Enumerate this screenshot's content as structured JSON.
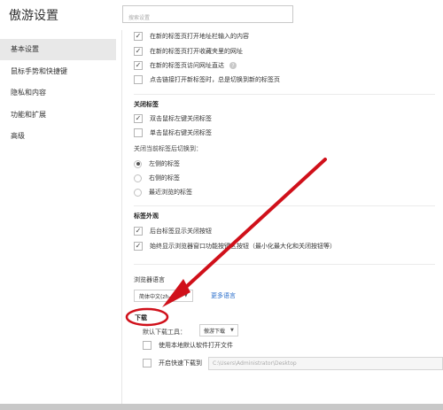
{
  "app": {
    "title": "傲游设置"
  },
  "search": {
    "placeholder": "搜索设置"
  },
  "sidebar": {
    "items": [
      {
        "label": "基本设置",
        "active": true
      },
      {
        "label": "鼠标手势和快捷键",
        "active": false
      },
      {
        "label": "隐私和内容",
        "active": false
      },
      {
        "label": "功能和扩展",
        "active": false
      },
      {
        "label": "高级",
        "active": false
      }
    ]
  },
  "tab_open": {
    "items": [
      {
        "label": "在新的标签页打开地址栏输入的内容",
        "checked": true
      },
      {
        "label": "在新的标签页打开收藏夹里的网址",
        "checked": true
      },
      {
        "label": "在新的标签页访问网址直达",
        "checked": true
      },
      {
        "label": "点击链接打开新标签时，总是切换到新的标签页",
        "checked": false
      }
    ]
  },
  "close_tab": {
    "title": "关闭标签",
    "items": [
      {
        "label": "双击鼠标左键关闭标签",
        "checked": true
      },
      {
        "label": "单击鼠标右键关闭标签",
        "checked": false
      }
    ],
    "switch_label": "关闭当前标签后切换到：",
    "options": [
      {
        "label": "左侧的标签",
        "selected": true
      },
      {
        "label": "右侧的标签",
        "selected": false
      },
      {
        "label": "最近浏览的标签",
        "selected": false
      }
    ]
  },
  "tab_appearance": {
    "title": "标签外观",
    "items": [
      {
        "label": "后台标签显示关闭按钮",
        "checked": true
      },
      {
        "label": "始终显示浏览器窗口功能按键区按钮（最小化最大化和关闭按钮等）",
        "checked": true
      }
    ]
  },
  "browser_language": {
    "title": "浏览器语言",
    "selected": "简体中文(zh-cn)",
    "more_link": "更多语言"
  },
  "download": {
    "title": "下载",
    "tool_label": "默认下载工具：",
    "tool_value": "傲游下载",
    "items": [
      {
        "label": "使用本地默认软件打开文件",
        "checked": false
      },
      {
        "label": "开启快速下载到",
        "checked": false
      }
    ],
    "path": "C:\\Users\\Administrator\\Desktop"
  },
  "icons": {
    "check": "check-icon",
    "info": "info-icon",
    "caret": "caret-down-icon"
  },
  "colors": {
    "annotation": "#d0101a",
    "link": "#2a6ecb",
    "sidebar_active": "#e8e8e8"
  }
}
